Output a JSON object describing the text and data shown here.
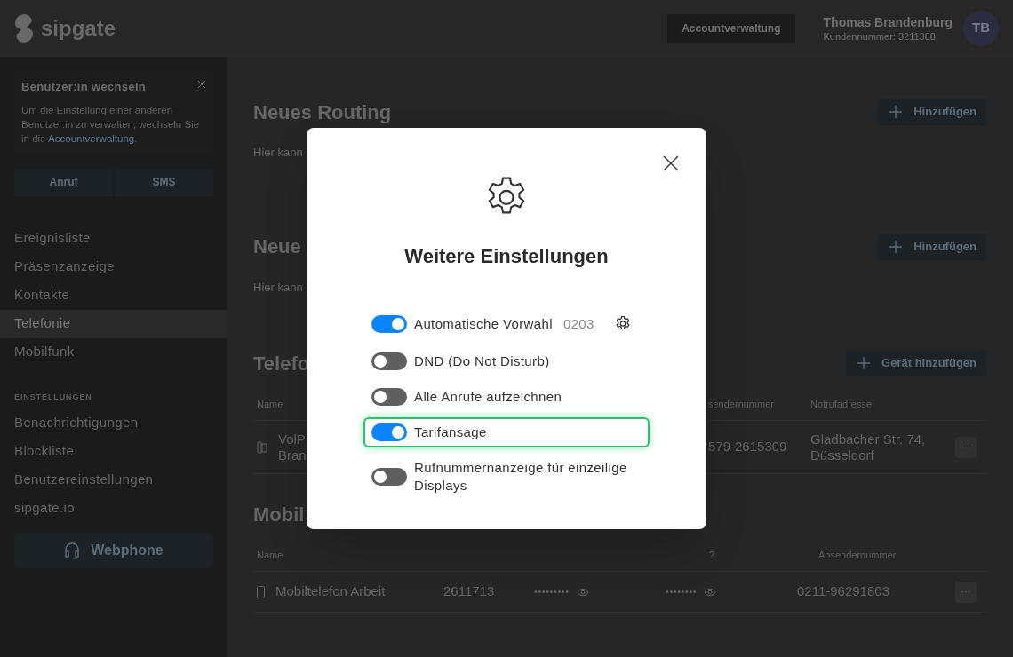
{
  "header": {
    "logo_text": "sipgate",
    "account_button": "Accountverwaltung",
    "user": {
      "name": "Thomas Brandenburg",
      "customer_number": "Kundennummer: 3211388",
      "initials": "TB"
    }
  },
  "sidebar": {
    "switch_user": {
      "title": "Benutzer:in wechseln",
      "text": "Um die Einstellung einer anderen Benutzer:in zu verwalten, wechseln Sie in die ",
      "link": "Accountverwaltung",
      "text_end": "."
    },
    "actions": [
      "Anruf",
      "SMS"
    ],
    "nav": [
      {
        "label": "Ereignisliste",
        "selected": false
      },
      {
        "label": "Präsenzanzeige",
        "selected": false
      },
      {
        "label": "Kontakte",
        "selected": false
      },
      {
        "label": "Telefonie",
        "selected": true
      },
      {
        "label": "Mobilfunk",
        "selected": false
      }
    ],
    "settings_heading": "EINSTELLUNGEN",
    "settings_nav": [
      {
        "label": "Benachrichtigungen",
        "selected": false
      },
      {
        "label": "Blockliste",
        "selected": false
      },
      {
        "label": "Benutzereinstellungen",
        "selected": false
      },
      {
        "label": "sipgate.io",
        "selected": false
      }
    ],
    "webphone_button": "Webphone"
  },
  "main": {
    "routing_sections": [
      {
        "title": "Neues Routing",
        "button": "Hinzufügen",
        "text": "Hier kann"
      },
      {
        "title": "Neue",
        "button": "Hinzufügen",
        "text": "Hier kann"
      }
    ],
    "devices": {
      "title": "Telefo",
      "button": "Gerät hinzufügen",
      "columns": [
        "Name",
        "sendernummer",
        "Notrufadresse"
      ],
      "rows": [
        {
          "name_lines": [
            "VolP",
            "Bran"
          ],
          "number": "579-2615309",
          "address": "Gladbacher Str. 74, Düsseldorf",
          "menu": "···"
        }
      ]
    },
    "mobile": {
      "title": "Mobil",
      "columns": [
        "Name",
        "?",
        "Absendernummer"
      ],
      "rows": [
        {
          "name": "Mobiltelefon Arbeit",
          "number": "2611713",
          "pin": "•••••••••",
          "puk": "••••••••",
          "sender": "0211-96291803",
          "menu": "···"
        }
      ]
    }
  },
  "modal": {
    "title": "Weitere Einstellungen",
    "settings": [
      {
        "label": "Automatische Vorwahl",
        "value": "0203",
        "on": true,
        "focused": false,
        "kind": "configurable"
      },
      {
        "label": "DND (Do Not Disturb)",
        "on": false,
        "focused": false,
        "kind": "plain"
      },
      {
        "label": "Alle Anrufe aufzeichnen",
        "on": false,
        "focused": false,
        "kind": "plain"
      },
      {
        "label": "Tarifansage",
        "on": true,
        "focused": true,
        "kind": "plain"
      },
      {
        "label": "Rufnummernanzeige für einzeilige Displays",
        "on": false,
        "focused": false,
        "kind": "plain"
      }
    ]
  }
}
